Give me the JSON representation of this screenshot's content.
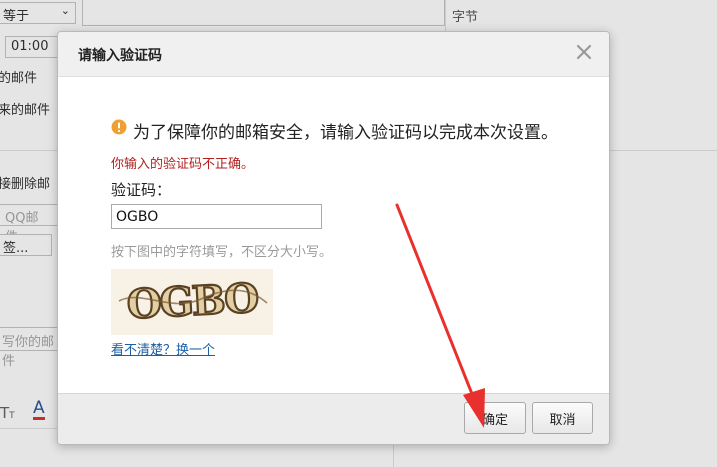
{
  "background": {
    "equals_select": "等于",
    "time_select": "01:00",
    "bytes_label": "字节",
    "mail_text_1": "的邮件",
    "mail_text_2": "来的邮件",
    "delete_text": "接删除邮",
    "qq_mail_placeholder": "QQ邮件",
    "tag_select": "签...",
    "write_placeholder": "写你的邮件"
  },
  "dialog": {
    "title": "请输入验证码",
    "notice": "为了保障你的邮箱安全，请输入验证码以完成本次设置。",
    "error": "你输入的验证码不正确。",
    "captcha_label": "验证码：",
    "captcha_value": "OGBO",
    "hint": "按下图中的字符填写，不区分大小写。",
    "captcha_image_text": "OGBO",
    "refresh_link": "看不清楚？换一个",
    "ok_label": "确定",
    "cancel_label": "取消"
  },
  "colors": {
    "error": "#b21f1f",
    "link": "#1d5fa5",
    "notice_icon": "#f0a030",
    "annotation_arrow": "#e8312e"
  },
  "icons": {
    "close": "close-icon",
    "notice": "warning-icon",
    "arrow": "annotation-arrow"
  }
}
